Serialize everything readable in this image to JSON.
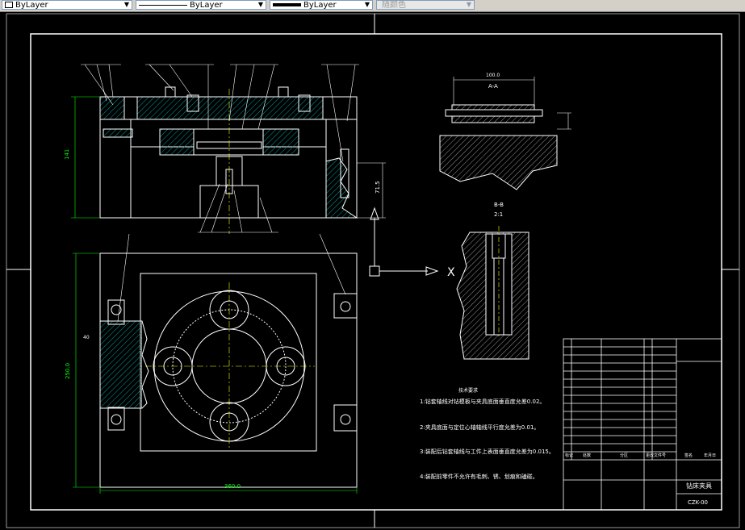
{
  "toolbar": {
    "color": "ByLayer",
    "linetype": "ByLayer",
    "lineweight": "ByLayer",
    "plotstyle": "随颜色"
  },
  "views": {
    "section_a_label": "A-A",
    "section_a_dim": "100.0",
    "section_b_label": "B-B",
    "section_b_scale": "2:1"
  },
  "dimensions": {
    "front_height": "141",
    "front_right": "71.5",
    "top_width": "360.0",
    "top_height": "250.0",
    "slot_width": "40"
  },
  "ucs": {
    "x_axis": "X"
  },
  "notes": {
    "title": "技术要求",
    "items": [
      "1:钻套轴线对钻模板与夹具底面垂直度允差0.02。",
      "2:夹具底面与定位心轴轴线平行度允差为0.01。",
      "3:装配后钻套轴线与工件上表面垂直度允差为0.015。",
      "4:装配前零件不允许有毛刺、锈、划痕和磕碰。"
    ]
  },
  "title_block": {
    "title": "钻床夹具",
    "code": "CZK-00",
    "headers": [
      "标记",
      "处数",
      "分区",
      "更改文件号",
      "签名",
      "年月日"
    ]
  }
}
